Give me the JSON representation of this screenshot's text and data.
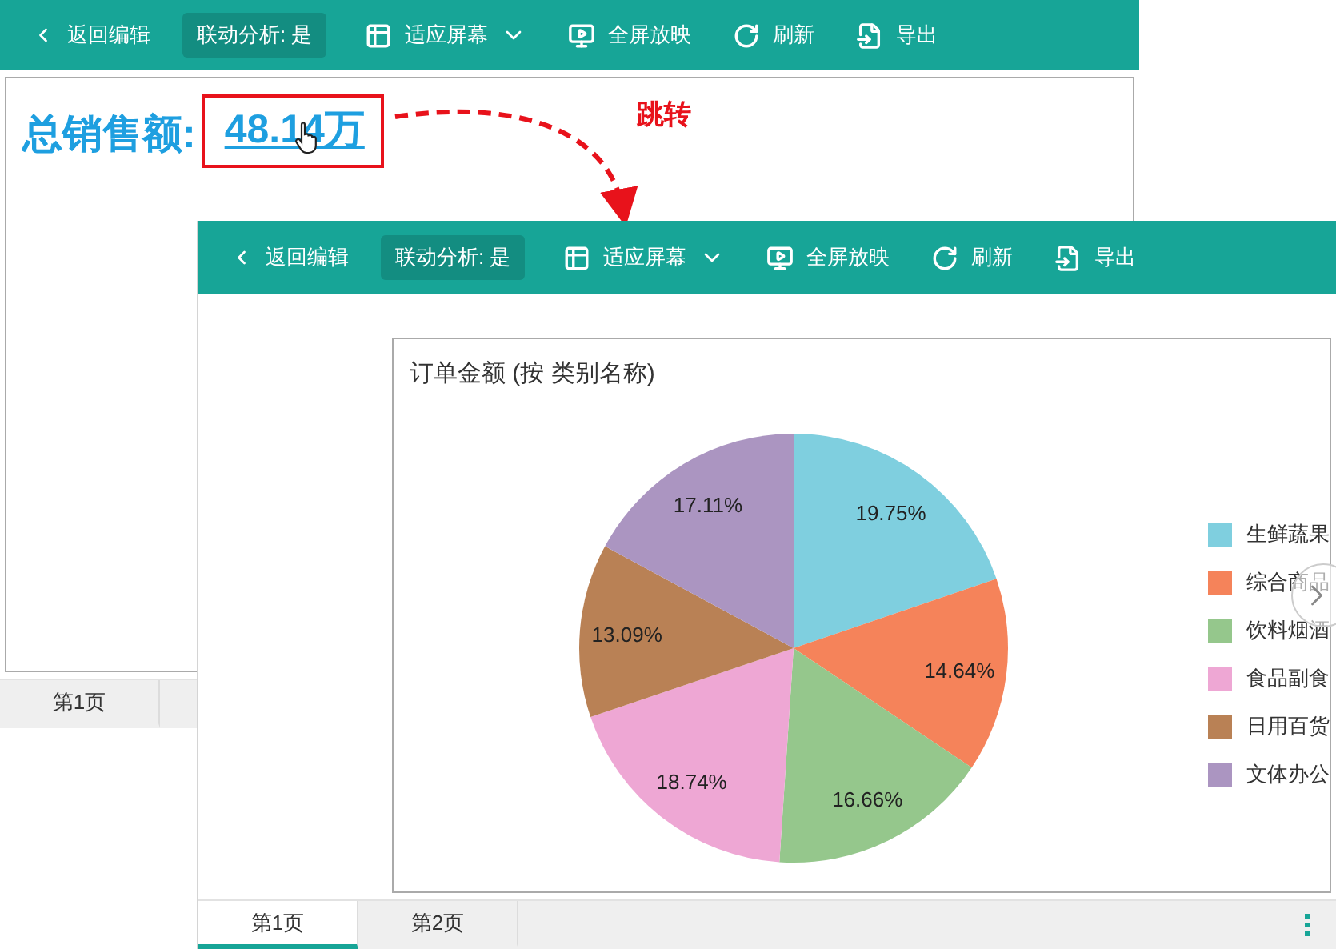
{
  "back_window": {
    "toolbar": [
      {
        "kind": "back",
        "label": "返回编辑"
      },
      {
        "kind": "toggle",
        "label": "联动分析: 是"
      },
      {
        "kind": "fit",
        "label": "适应屏幕"
      },
      {
        "kind": "fullscreen",
        "label": "全屏放映"
      },
      {
        "kind": "refresh",
        "label": "刷新"
      },
      {
        "kind": "export",
        "label": "导出"
      }
    ],
    "metric": {
      "label": "总销售额:",
      "value": "48.14万"
    },
    "tabs": [
      {
        "label": "第1页",
        "selected": false
      }
    ]
  },
  "annotation": {
    "text": "跳转"
  },
  "front_window": {
    "toolbar": [
      {
        "kind": "back",
        "label": "返回编辑"
      },
      {
        "kind": "toggle",
        "label": "联动分析: 是"
      },
      {
        "kind": "fit",
        "label": "适应屏幕"
      },
      {
        "kind": "fullscreen",
        "label": "全屏放映"
      },
      {
        "kind": "refresh",
        "label": "刷新"
      },
      {
        "kind": "export",
        "label": "导出"
      }
    ],
    "chart": {
      "chart_data": {
        "type": "pie",
        "title": "订单金额 (按 类别名称)",
        "categories": [
          "生鲜蔬果",
          "综合商品",
          "饮料烟酒",
          "食品副食",
          "日用百货",
          "文体办公"
        ],
        "values": [
          19.75,
          14.64,
          16.66,
          18.74,
          13.09,
          17.11
        ],
        "value_labels": [
          "19.75%",
          "14.64%",
          "16.66%",
          "18.74%",
          "13.09%",
          "17.11%"
        ]
      },
      "legend": [
        {
          "color": "#7fcfdf"
        },
        {
          "color": "#f5835a"
        },
        {
          "color": "#95c78c"
        },
        {
          "color": "#eea7d4"
        },
        {
          "color": "#b98155"
        },
        {
          "color": "#ab95c1"
        }
      ]
    },
    "tabs": [
      {
        "label": "第1页",
        "selected": true
      },
      {
        "label": "第2页",
        "selected": false
      }
    ]
  }
}
